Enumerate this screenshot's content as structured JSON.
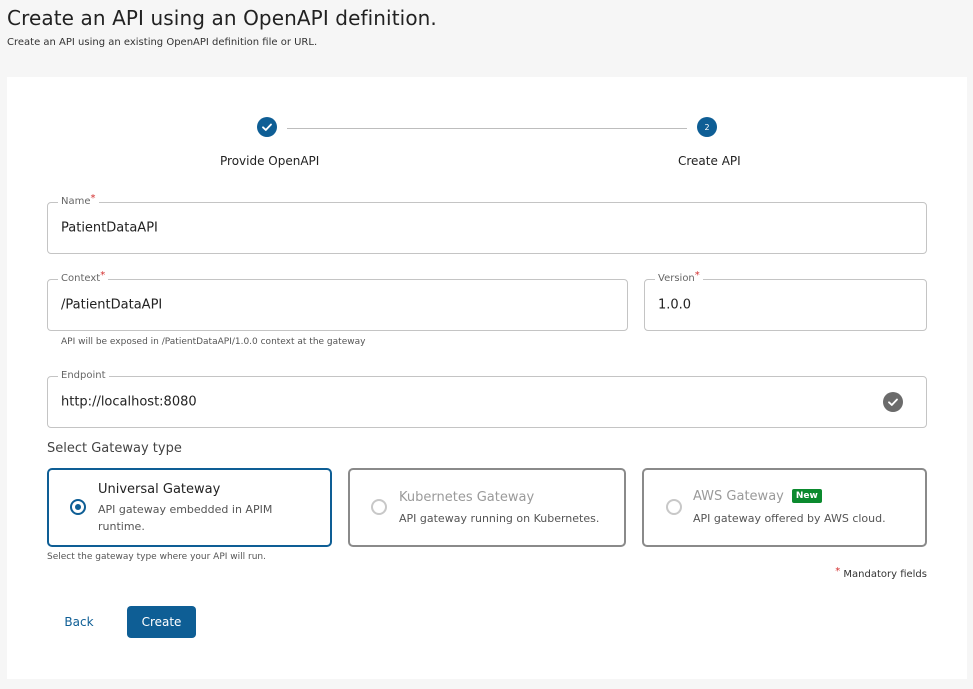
{
  "header": {
    "title": "Create an API using an OpenAPI definition.",
    "subtitle": "Create an API using an existing OpenAPI definition file or URL."
  },
  "stepper": {
    "steps": [
      {
        "label": "Provide OpenAPI",
        "state": "completed",
        "icon": "check-icon"
      },
      {
        "label": "Create API",
        "state": "active",
        "number": "2"
      }
    ]
  },
  "form": {
    "name": {
      "label": "Name",
      "required_mark": "*",
      "value": "PatientDataAPI"
    },
    "context": {
      "label": "Context",
      "required_mark": "*",
      "value": "/PatientDataAPI",
      "helper": "API will be exposed in /PatientDataAPI/1.0.0 context at the gateway"
    },
    "version": {
      "label": "Version",
      "required_mark": "*",
      "value": "1.0.0"
    },
    "endpoint": {
      "label": "Endpoint",
      "value": "http://localhost:8080",
      "status_icon": "check-circle-icon"
    }
  },
  "gateway": {
    "title": "Select Gateway type",
    "options": [
      {
        "title": "Universal Gateway",
        "description": "API gateway embedded in APIM runtime.",
        "selected": true
      },
      {
        "title": "Kubernetes Gateway",
        "description": "API gateway running on Kubernetes.",
        "selected": false
      },
      {
        "title": "AWS Gateway",
        "badge": "New",
        "description": "API gateway offered by AWS cloud.",
        "selected": false
      }
    ],
    "helper": "Select the gateway type where your API will run."
  },
  "mandatory": {
    "mark": "*",
    "text": "Mandatory fields"
  },
  "actions": {
    "back_label": "Back",
    "create_label": "Create"
  },
  "colors": {
    "primary": "#0e5e95",
    "badge_green": "#0b8a2e",
    "required_red": "#d32f2f"
  }
}
